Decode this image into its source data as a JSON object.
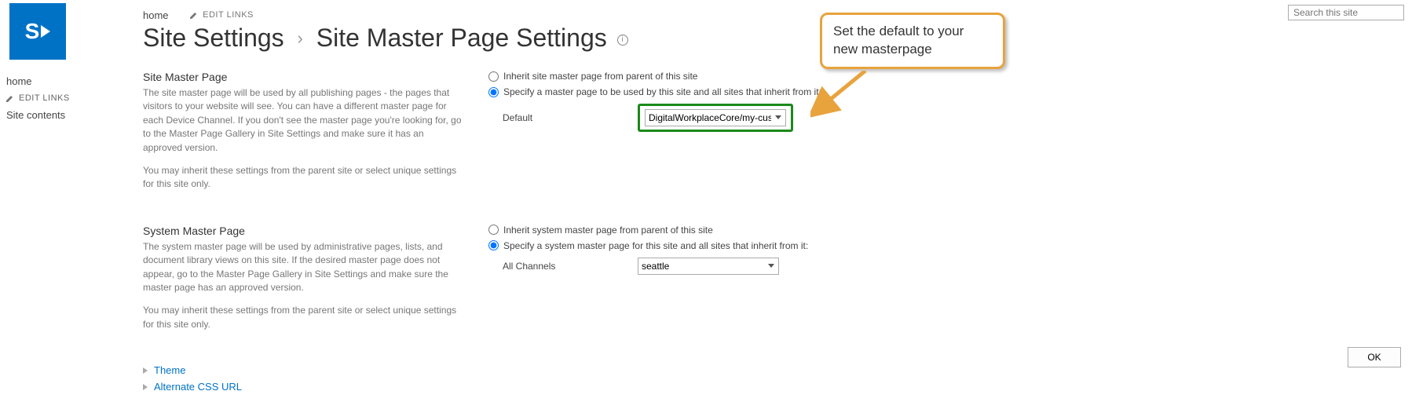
{
  "breadcrumb": {
    "home": "home",
    "edit_links": "EDIT LINKS"
  },
  "page_title": {
    "prefix": "Site Settings",
    "suffix": "Site Master Page Settings"
  },
  "search": {
    "placeholder": "Search this site"
  },
  "left_nav": {
    "home": "home",
    "edit_links": "EDIT LINKS",
    "site_contents": "Site contents"
  },
  "site_master": {
    "heading": "Site Master Page",
    "desc1": "The site master page will be used by all publishing pages - the pages that visitors to your website will see. You can have a different master page for each Device Channel. If you don't see the master page you're looking for, go to the Master Page Gallery in Site Settings and make sure it has an approved version.",
    "desc2": "You may inherit these settings from the parent site or select unique settings for this site only.",
    "radio_inherit": "Inherit site master page from parent of this site",
    "radio_specify": "Specify a master page to be used by this site and all sites that inherit from it:",
    "field_label": "Default",
    "field_value": "DigitalWorkplaceCore/my-cust"
  },
  "system_master": {
    "heading": "System Master Page",
    "desc1": "The system master page will be used by administrative pages, lists, and document library views on this site. If the desired master page does not appear, go to the Master Page Gallery in Site Settings and make sure the master page has an approved version.",
    "desc2": "You may inherit these settings from the parent site or select unique settings for this site only.",
    "radio_inherit": "Inherit system master page from parent of this site",
    "radio_specify": "Specify a system master page for this site and all sites that inherit from it:",
    "field_label": "All Channels",
    "field_value": "seattle"
  },
  "expand": {
    "theme": "Theme",
    "css": "Alternate CSS URL"
  },
  "callout_text": "Set the default to your new masterpage",
  "ok_label": "OK"
}
